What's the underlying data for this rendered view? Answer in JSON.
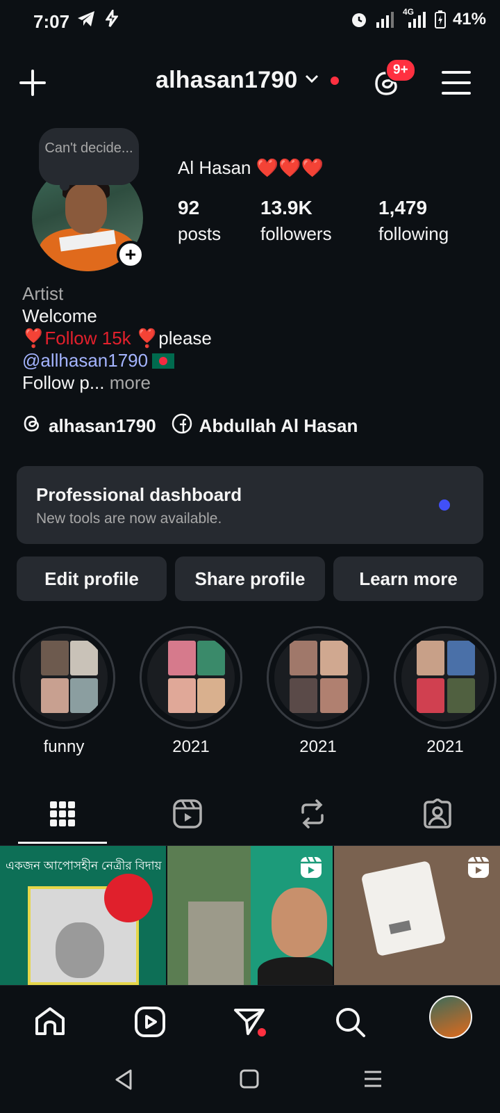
{
  "status_bar": {
    "time": "7:07",
    "battery": "41%",
    "network": "4G",
    "icons": [
      "telegram-icon",
      "bolt-app-icon",
      "alarm-icon",
      "signal-icon",
      "battery-icon"
    ]
  },
  "header": {
    "username": "alhasan1790",
    "notification_badge": "9+",
    "icons": [
      "new-post-plus-icon",
      "chevron-down-icon",
      "threads-icon",
      "menu-icon"
    ]
  },
  "profile": {
    "note": "Can't decide...",
    "display_name": "Al Hasan ❤️❤️❤️",
    "stats": [
      {
        "value": "92",
        "label": "posts"
      },
      {
        "value": "13.9K",
        "label": "followers"
      },
      {
        "value": "1,479",
        "label": "following"
      }
    ],
    "bio": {
      "category": "Artist",
      "line1": "Welcome",
      "line2_a": "❣️Follow 15k ",
      "line2_b": "❣️please",
      "mention": "@allhasan1790",
      "line4": "Follow p...",
      "more": " more"
    },
    "links": [
      {
        "icon": "threads-icon",
        "text": "alhasan1790"
      },
      {
        "icon": "facebook-icon",
        "text": "Abdullah Al Hasan"
      }
    ]
  },
  "dashboard": {
    "title": "Professional dashboard",
    "subtitle": "New tools are now available.",
    "dot_color": "#4150f7"
  },
  "buttons": {
    "edit": "Edit profile",
    "share": "Share profile",
    "learn": "Learn more"
  },
  "highlights": [
    {
      "label": "funny"
    },
    {
      "label": "2021"
    },
    {
      "label": "2021"
    },
    {
      "label": "2021"
    }
  ],
  "tabs": [
    "grid-icon",
    "reels-icon",
    "reposts-icon",
    "tagged-icon"
  ],
  "grid": {
    "post1_caption": "একজন আপোসহীন নেত্রীর বিদায়"
  },
  "bottom_nav": [
    "home-icon",
    "reels-icon",
    "messages-icon",
    "search-icon",
    "profile-avatar"
  ],
  "colors": {
    "background": "#0c1014",
    "card": "#262a30",
    "accent_red": "#ff3040",
    "mention_blue": "#a4b4ff"
  }
}
